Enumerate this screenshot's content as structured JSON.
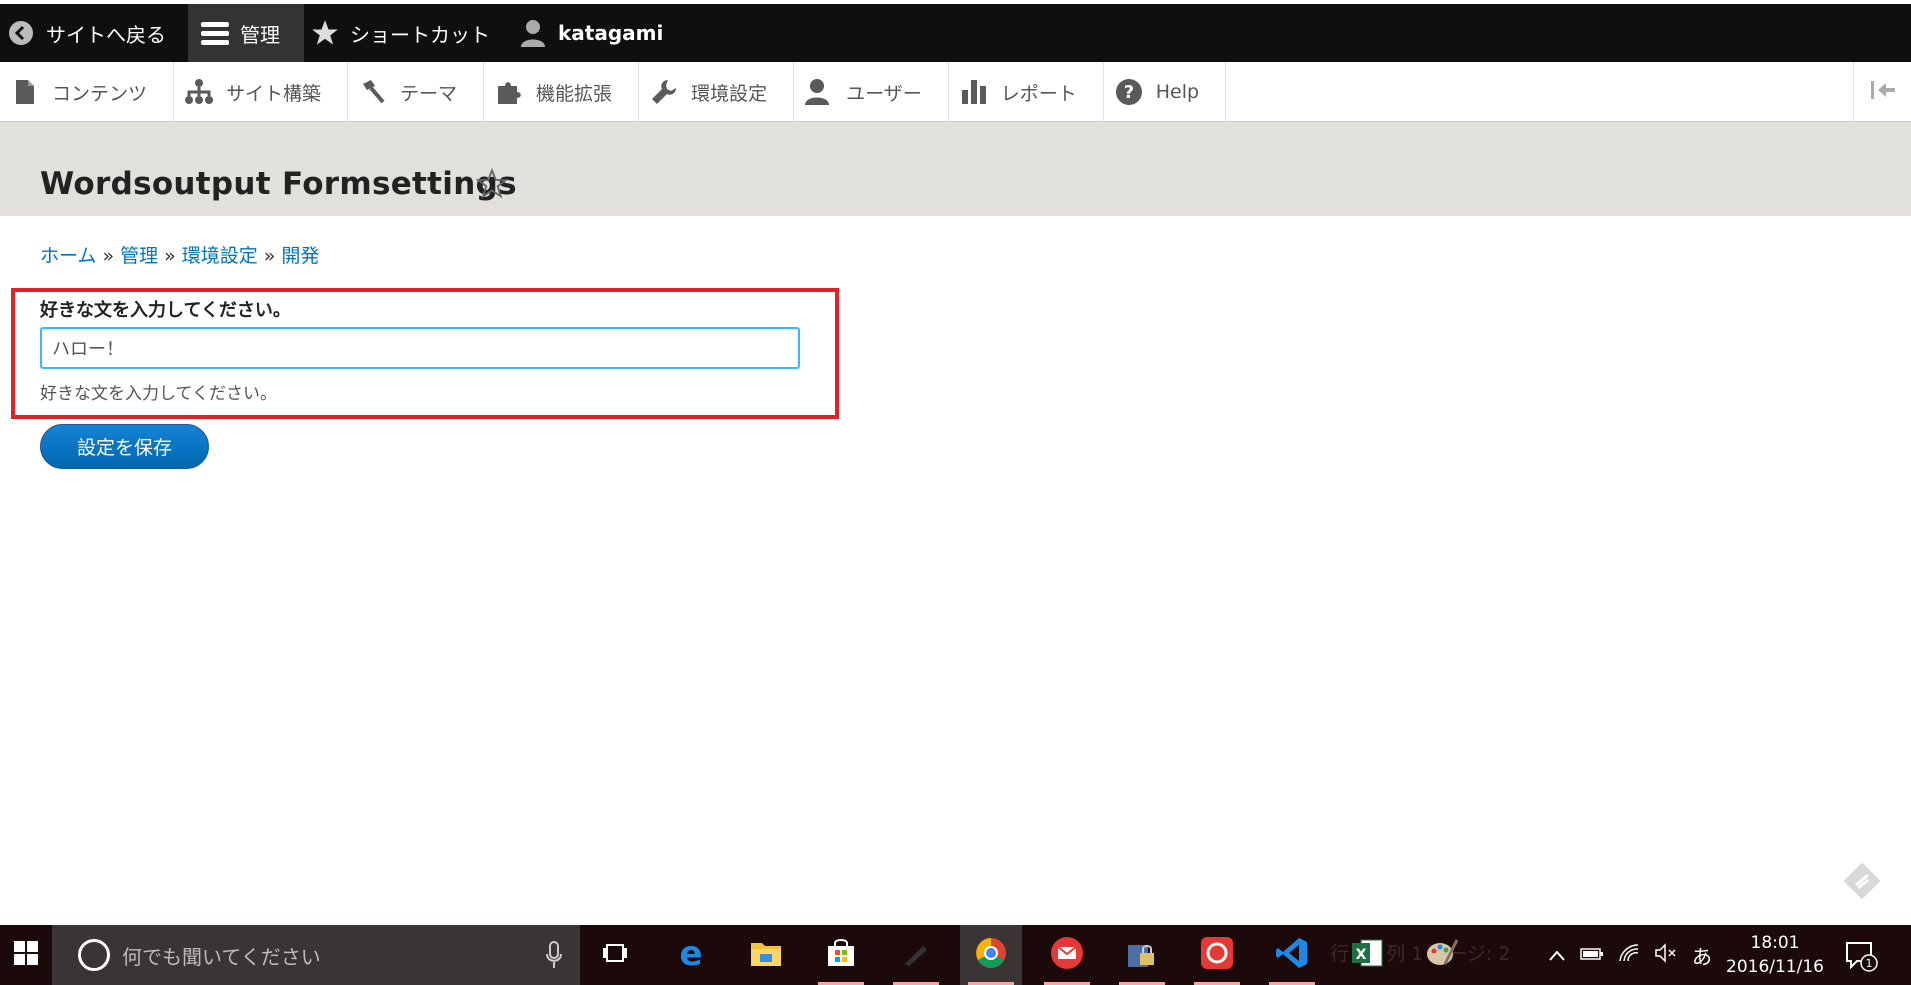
{
  "toolbar": {
    "back": "サイトへ戻る",
    "manage": "管理",
    "shortcuts": "ショートカット",
    "user": "katagami"
  },
  "tray": {
    "items": [
      "コンテンツ",
      "サイト構築",
      "テーマ",
      "機能拡張",
      "環境設定",
      "ユーザー",
      "レポート",
      "Help"
    ]
  },
  "page": {
    "title": "Wordsoutput Formsettings"
  },
  "breadcrumb": {
    "items": [
      "ホーム",
      "管理",
      "環境設定",
      "開発"
    ],
    "separator": "»"
  },
  "form": {
    "label": "好きな文を入力してください。",
    "value": "ハロー！",
    "description": "好きな文を入力してください。",
    "submit": "設定を保存"
  },
  "taskbar": {
    "search_placeholder": "何でも聞いてください",
    "faint_text": "行 1、列 1 ページ: 2",
    "ime": "あ",
    "time": "18:01",
    "date": "2016/11/16",
    "notification_count": "1"
  },
  "colors": {
    "toolbar_bg": "#0f0f0f",
    "header_bg": "#e1e0da",
    "link": "#0074bd",
    "highlight": "#e0212b",
    "button": "#0067b0"
  }
}
